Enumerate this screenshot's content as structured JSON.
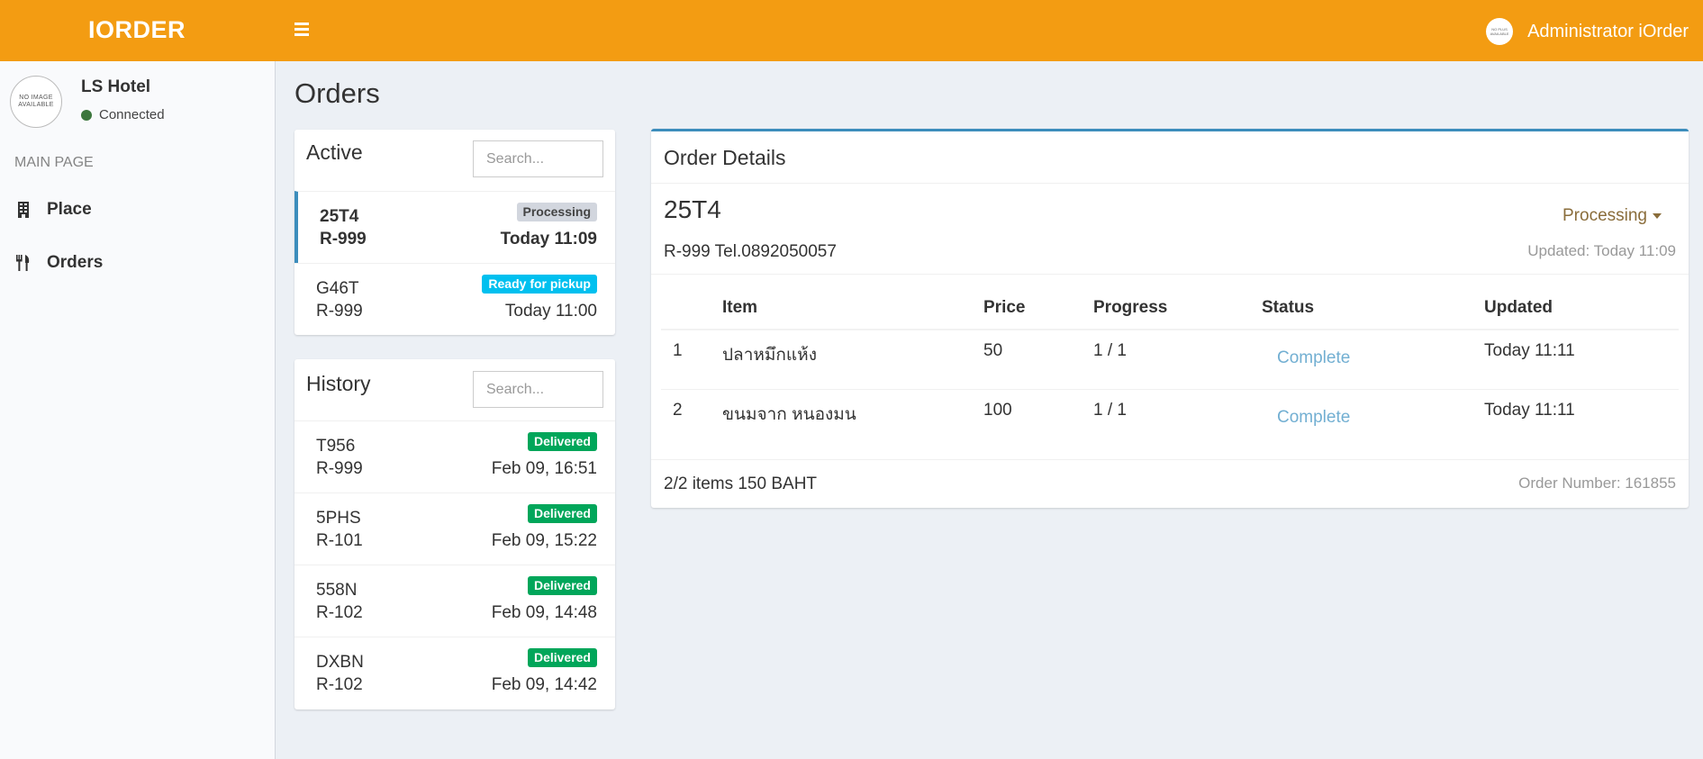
{
  "app": {
    "logo": "IORDER",
    "user_name": "Administrator iOrder",
    "user_avatar_text": "NO PLUS AVAILABLE"
  },
  "sidebar": {
    "avatar_text": "NO IMAGE AVAILABLE",
    "hotel_name": "LS Hotel",
    "status": "Connected",
    "section_header": "MAIN PAGE",
    "items": [
      {
        "label": "Place",
        "icon": "building-icon"
      },
      {
        "label": "Orders",
        "icon": "cutlery-icon"
      }
    ]
  },
  "page": {
    "title": "Orders"
  },
  "active": {
    "title": "Active",
    "search_placeholder": "Search...",
    "orders": [
      {
        "code": "25T4",
        "table": "R-999",
        "badge": "Processing",
        "time": "Today 11:09"
      },
      {
        "code": "G46T",
        "table": "R-999",
        "badge": "Ready for pickup",
        "time": "Today 11:00"
      }
    ]
  },
  "history": {
    "title": "History",
    "search_placeholder": "Search...",
    "orders": [
      {
        "code": "T956",
        "table": "R-999",
        "badge": "Delivered",
        "time": "Feb 09, 16:51"
      },
      {
        "code": "5PHS",
        "table": "R-101",
        "badge": "Delivered",
        "time": "Feb 09, 15:22"
      },
      {
        "code": "558N",
        "table": "R-102",
        "badge": "Delivered",
        "time": "Feb 09, 14:48"
      },
      {
        "code": "DXBN",
        "table": "R-102",
        "badge": "Delivered",
        "time": "Feb 09, 14:42"
      }
    ]
  },
  "details": {
    "title": "Order Details",
    "code": "25T4",
    "status": "Processing",
    "contact": "R-999 Tel.0892050057",
    "updated": "Updated: Today 11:09",
    "columns": [
      "Item",
      "Price",
      "Progress",
      "Status",
      "Updated"
    ],
    "rows": [
      {
        "num": "1",
        "item": "ปลาหมึกแห้ง",
        "price": "50",
        "progress": "1 / 1",
        "status": "Complete",
        "updated": "Today 11:11"
      },
      {
        "num": "2",
        "item": "ขนมจาก หนองมน",
        "price": "100",
        "progress": "1 / 1",
        "status": "Complete",
        "updated": "Today 11:11"
      }
    ],
    "summary": "2/2 items 150 BAHT",
    "order_number": "Order Number: 161855"
  },
  "colors": {
    "header": "#f39c12",
    "accent": "#3c8dbc",
    "delivered": "#00a65a",
    "ready": "#00c0ef",
    "processing": "#d2d6de",
    "connected": "#3c763d"
  }
}
